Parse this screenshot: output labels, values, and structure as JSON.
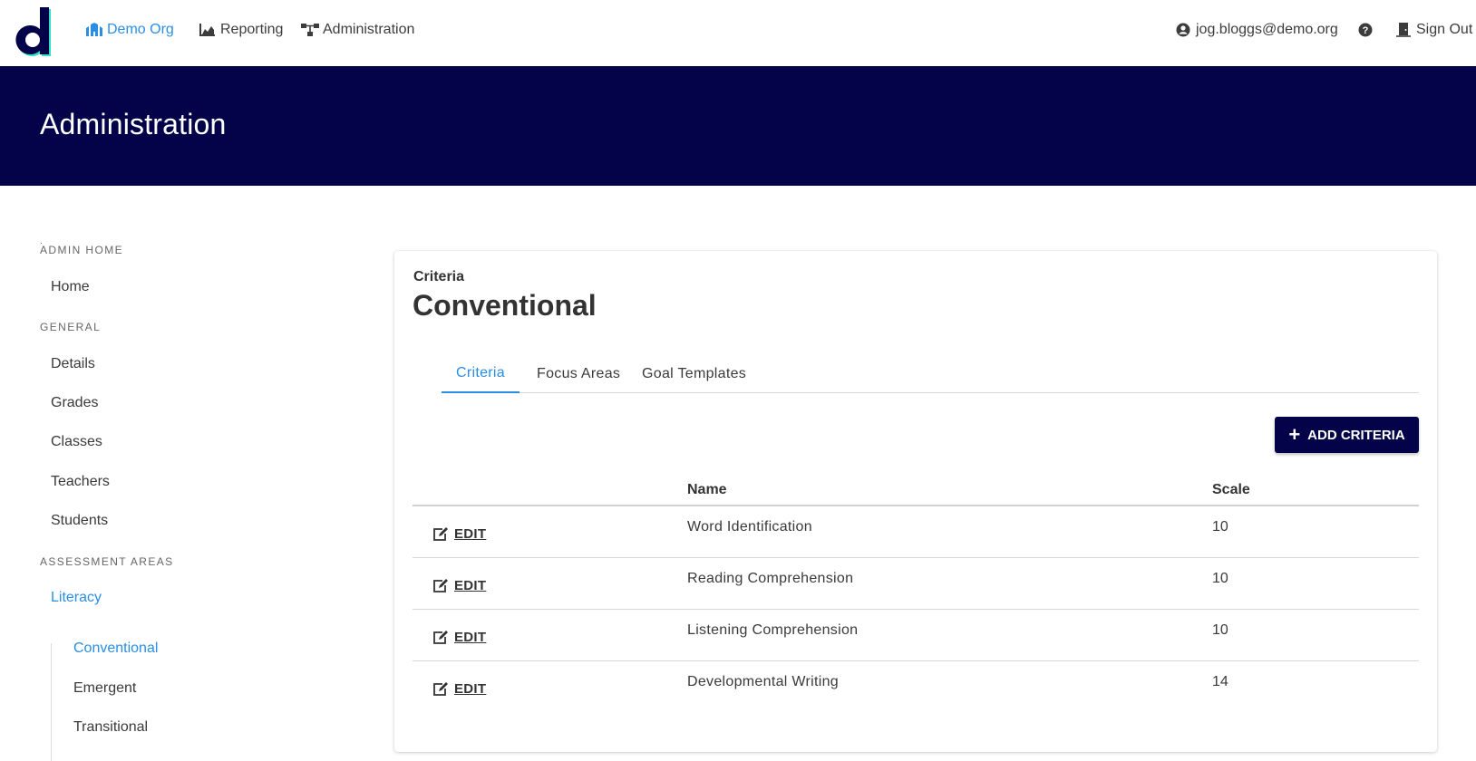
{
  "nav": {
    "org_label": "Demo Org",
    "reporting_label": "Reporting",
    "administration_label": "Administration",
    "user_email": "jog.bloggs@demo.org",
    "signout_label": "Sign Out",
    "help_icon": "question-circle-icon",
    "active_color": "#2a8ee6"
  },
  "banner": {
    "title": "Administration",
    "background": "#04034a"
  },
  "sidebar": {
    "dot": ".",
    "sections": [
      {
        "heading": "ADMIN HOME",
        "items": [
          "Home"
        ]
      },
      {
        "heading": "GENERAL",
        "items": [
          "Details",
          "Grades",
          "Classes",
          "Teachers",
          "Students"
        ]
      },
      {
        "heading": "ASSESSMENT AREAS",
        "items": [
          "Literacy"
        ]
      }
    ],
    "active_item": "Literacy",
    "sub_items": [
      "Conventional",
      "Emergent",
      "Transitional"
    ],
    "active_sub_item": "Conventional"
  },
  "card": {
    "subtitle": "Criteria",
    "title": "Conventional",
    "tabs": [
      "Criteria",
      "Focus Areas",
      "Goal Templates"
    ],
    "active_tab": "Criteria",
    "add_button_label": "ADD CRITERIA",
    "table": {
      "headers": {
        "name": "Name",
        "scale": "Scale"
      },
      "edit_label": "EDIT",
      "rows": [
        {
          "name": "Word Identification",
          "scale": "10"
        },
        {
          "name": "Reading Comprehension",
          "scale": "10"
        },
        {
          "name": "Listening Comprehension",
          "scale": "10"
        },
        {
          "name": "Developmental Writing",
          "scale": "14"
        }
      ]
    }
  }
}
